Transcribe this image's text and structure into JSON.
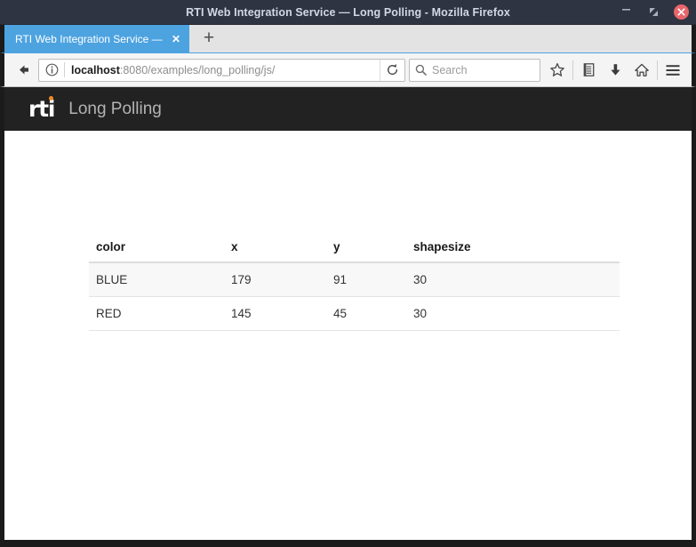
{
  "window": {
    "title": "RTI Web Integration Service — Long Polling - Mozilla Firefox",
    "minimize_label": "–",
    "maximize_label": "maximize-icon",
    "close_label": "✕"
  },
  "tabs": {
    "items": [
      {
        "title": "RTI Web Integration Service —",
        "close_label": "✕",
        "active": true
      }
    ],
    "new_tab_label": "+"
  },
  "toolbar": {
    "back_label": "back-arrow-icon",
    "identity_label": "info-icon",
    "url_host": "localhost",
    "url_rest": ":8080/examples/long_polling/js/",
    "reload_label": "reload-icon",
    "search_placeholder": "Search",
    "bookmark_label": "star-icon",
    "library_label": "library-icon",
    "downloads_label": "download-icon",
    "home_label": "home-icon",
    "menu_label": "hamburger-menu-icon"
  },
  "site": {
    "logo_text": "rti",
    "logo_dot_color": "#f08a24",
    "page_title": "Long Polling",
    "header_bg": "#222222"
  },
  "table": {
    "columns": [
      "color",
      "x",
      "y",
      "shapesize"
    ],
    "rows": [
      {
        "color": "BLUE",
        "x": "179",
        "y": "91",
        "shapesize": "30"
      },
      {
        "color": "RED",
        "x": "145",
        "y": "45",
        "shapesize": "30"
      }
    ]
  },
  "colors": {
    "titlebar": "#2f3442",
    "tab_active": "#4da3e0",
    "tabstrip": "#e3e3e3",
    "close_button": "#e8666a",
    "accent_orange": "#f08a24"
  }
}
